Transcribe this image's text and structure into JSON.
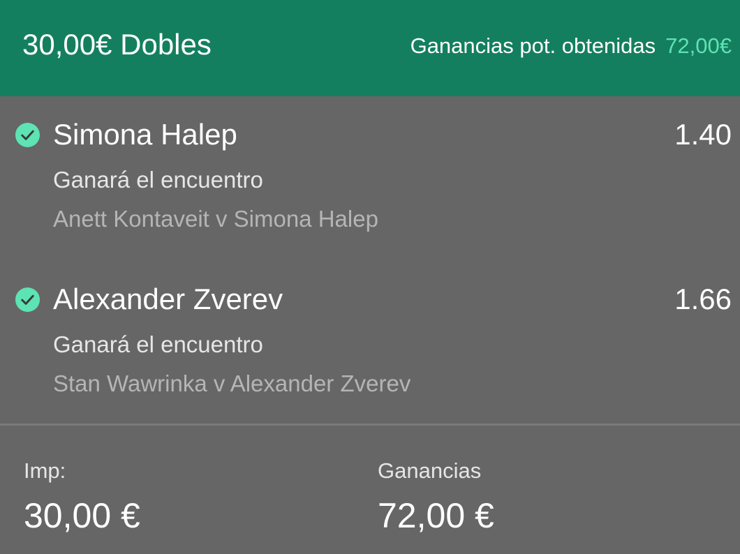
{
  "header": {
    "bet_title": "30,00€ Dobles",
    "potential_label": "Ganancias pot. obtenidas",
    "potential_amount": "72,00€"
  },
  "selections": [
    {
      "name": "Simona Halep",
      "odds": "1.40",
      "market": "Ganará el encuentro",
      "event": "Anett Kontaveit v Simona Halep",
      "status_icon": "check-circle-icon"
    },
    {
      "name": "Alexander Zverev",
      "odds": "1.66",
      "market": "Ganará el encuentro",
      "event": "Stan Wawrinka v Alexander Zverev",
      "status_icon": "check-circle-icon"
    }
  ],
  "footer": {
    "stake_label": "Imp:",
    "stake_value": "30,00 €",
    "returns_label": "Ganancias",
    "returns_value": "72,00 €"
  },
  "colors": {
    "header_bg": "#147f5e",
    "body_bg": "#666666",
    "accent_amount": "#5ee3b4",
    "check_bg": "#5ee3b4"
  }
}
